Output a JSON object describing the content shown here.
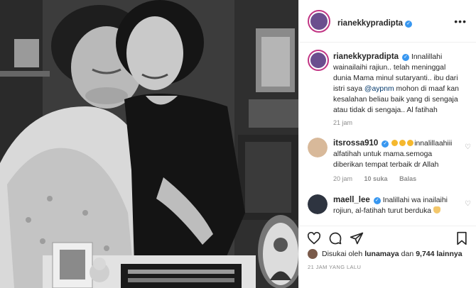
{
  "post": {
    "author": "rianekkypradipta",
    "verified_mark": "✓",
    "more_label": "•••"
  },
  "comments": [
    {
      "user": "rianekkypradipta",
      "text_1": "Innalillahi wainailaihi rajiun.. telah meninggal dunia Mama minul sutaryanti.. ibu dari istri saya",
      "mention": "@aypnm",
      "text_2": "mohon di maaf kan kesalahan beliau baik yang di sengaja atau tidak di sengaja.. Al fatihah",
      "time": "21 jam"
    },
    {
      "user": "itsrossa910",
      "text_1": "innalillaahiii alfatihah untuk mama.semoga diberikan tempat terbaik dr Allah",
      "time": "20 jam",
      "likes": "10 suka",
      "reply": "Balas"
    },
    {
      "user": "maell_lee",
      "text_1": "Inalillahi wa inailaihi rojiun, al-fatihah turut berduka"
    }
  ],
  "likes": {
    "prefix": "Disukai oleh",
    "user": "lunamaya",
    "connector": "dan",
    "count": "9,744 lainnya"
  },
  "time_ago": "21 JAM YANG LALU",
  "icons": [
    "heart-icon",
    "comment-icon",
    "share-icon",
    "bookmark-icon",
    "more-icon",
    "verified-icon"
  ],
  "colors": {
    "link": "#00376b",
    "verified": "#3897f0",
    "muted": "#8e8e8e"
  }
}
